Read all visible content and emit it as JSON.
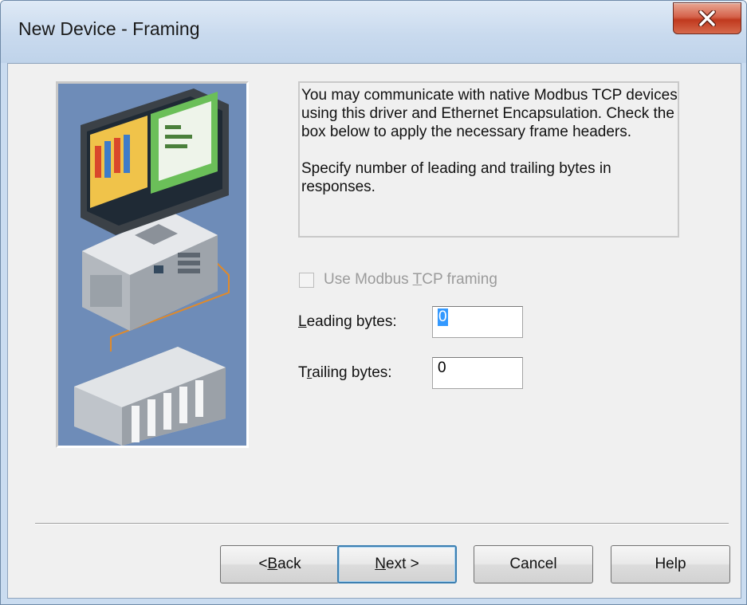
{
  "window": {
    "title": "New Device - Framing"
  },
  "description": {
    "paragraph1": "You may communicate with native Modbus TCP devices using this driver and Ethernet Encapsulation. Check the box below to apply the necessary frame headers.",
    "paragraph2": "Specify number of leading and trailing bytes in responses."
  },
  "framing_checkbox": {
    "label_before": "Use Modbus ",
    "label_accel": "T",
    "label_after": "CP framing",
    "checked": false,
    "enabled": false
  },
  "leading_bytes": {
    "label_accel": "L",
    "label_rest": "eading bytes:",
    "value": "0"
  },
  "trailing_bytes": {
    "label_before": "T",
    "label_accel": "r",
    "label_rest": "ailing bytes:",
    "value": "0"
  },
  "buttons": {
    "back_prefix": "< ",
    "back_accel": "B",
    "back_rest": "ack",
    "next_accel": "N",
    "next_rest": "ext >",
    "cancel": "Cancel",
    "help": "Help"
  },
  "colors": {
    "illustration_background": "#6e8cb8",
    "close_button": "#c0391e",
    "selection": "#3399ff"
  }
}
